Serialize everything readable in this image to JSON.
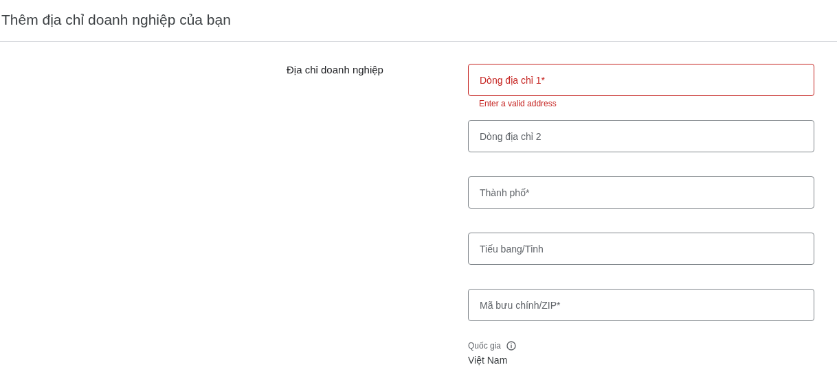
{
  "title": "Thêm địa chỉ doanh nghiệp của bạn",
  "section_label": "Địa chỉ doanh nghiệp",
  "fields": [
    {
      "placeholder": "Dòng địa chỉ 1*",
      "error": true,
      "error_text": "Enter a valid address"
    },
    {
      "placeholder": "Dòng địa chỉ 2",
      "error": false
    },
    {
      "placeholder": "Thành phố*",
      "error": false
    },
    {
      "placeholder": "Tiếu bang/Tỉnh",
      "error": false
    },
    {
      "placeholder": "Mã bưu chính/ZIP*",
      "error": false
    }
  ],
  "country": {
    "label": "Quốc gia",
    "value": "Việt Nam"
  }
}
